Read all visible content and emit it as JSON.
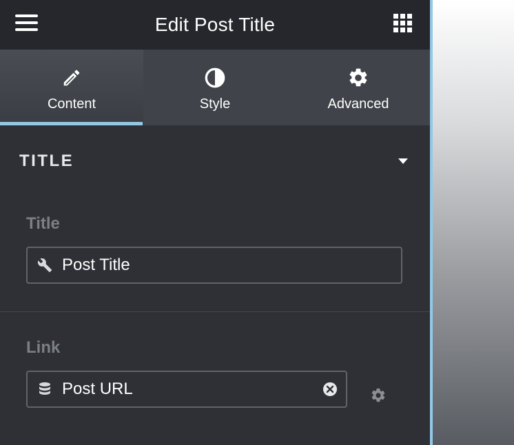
{
  "header": {
    "title": "Edit Post Title",
    "menu_icon": "hamburger-menu-icon",
    "apps_icon": "apps-grid-icon"
  },
  "tabs": [
    {
      "label": "Content",
      "icon": "pencil-icon",
      "active": true
    },
    {
      "label": "Style",
      "icon": "contrast-icon",
      "active": false
    },
    {
      "label": "Advanced",
      "icon": "gear-icon",
      "active": false
    }
  ],
  "section": {
    "title": "TITLE",
    "expanded": true
  },
  "fields": {
    "title": {
      "label": "Title",
      "value": "Post Title",
      "icon": "wrench-icon"
    },
    "link": {
      "label": "Link",
      "value": "Post URL",
      "icon": "database-icon",
      "clear_icon": "clear-icon",
      "settings_icon": "gear-icon"
    }
  },
  "colors": {
    "accent": "#93c9e6",
    "panel": "#2f3036",
    "header": "#26272c",
    "tabs": "#404349"
  }
}
